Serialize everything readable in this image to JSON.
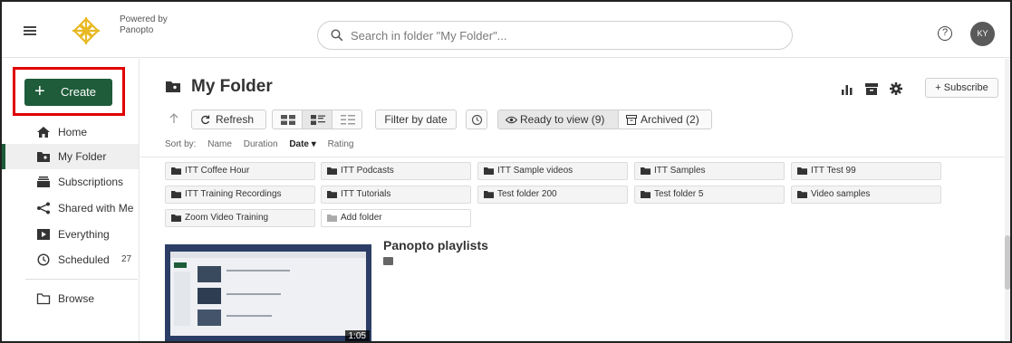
{
  "header": {
    "powered_line1": "Powered by",
    "powered_line2": "Panopto",
    "search_placeholder": "Search in folder \"My Folder\"...",
    "help_glyph": "?",
    "avatar_initials": "KY"
  },
  "sidebar": {
    "create_label": "Create",
    "items": [
      {
        "label": "Home",
        "icon": "home-icon"
      },
      {
        "label": "My Folder",
        "icon": "folder-user-icon"
      },
      {
        "label": "Subscriptions",
        "icon": "subscriptions-icon"
      },
      {
        "label": "Shared with Me",
        "icon": "share-icon"
      },
      {
        "label": "Everything",
        "icon": "video-library-icon"
      },
      {
        "label": "Scheduled",
        "icon": "clock-icon",
        "count": "27"
      },
      {
        "label": "Browse",
        "icon": "folder-outline-icon"
      }
    ]
  },
  "main": {
    "title": "My Folder",
    "subscribe_label": "+ Subscribe",
    "toolbar": {
      "refresh": "Refresh",
      "filter_by_date": "Filter by date",
      "ready_to_view": "Ready to view (9)",
      "archived": "Archived (2)"
    },
    "sort": {
      "prefix": "Sort by:",
      "options": [
        "Name",
        "Duration",
        "Date ▾",
        "Rating"
      ]
    },
    "folders": [
      "ITT Coffee Hour",
      "ITT Podcasts",
      "ITT Sample videos",
      "ITT Samples",
      "ITT Test 99",
      "ITT Training Recordings",
      "ITT Tutorials",
      "Test folder 200",
      "Test folder 5",
      "Video samples",
      "Zoom Video Training"
    ],
    "add_folder": "Add folder",
    "session": {
      "title": "Panopto playlists",
      "duration": "1:05"
    }
  },
  "colors": {
    "brand_green": "#1e5c3a",
    "highlight_red": "#e00000",
    "logo_gold": "#e8b923"
  }
}
